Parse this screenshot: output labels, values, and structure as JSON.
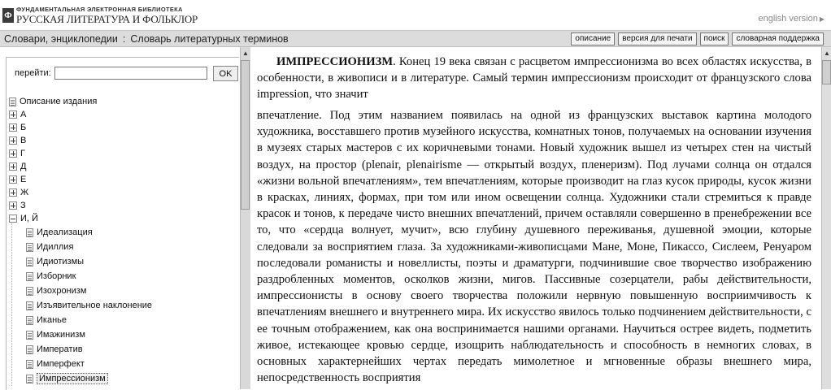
{
  "header": {
    "logo_top": "ФУНДАМЕНТАЛЬНАЯ ЭЛЕКТРОННАЯ БИБЛИОТЕКА",
    "logo_bottom": "РУССКАЯ ЛИТЕРАТУРА И ФОЛЬКЛОР",
    "english": "english version"
  },
  "titlebar": {
    "section": "Словари, энциклопедии",
    "separator": ":",
    "page": "Словарь литературных терминов",
    "buttons": [
      "описание",
      "версия для печати",
      "поиск",
      "словарная поддержка"
    ]
  },
  "goto": {
    "label": "перейти:",
    "value": "",
    "button": "OK"
  },
  "tree": {
    "root": "Описание издания",
    "letters": [
      "А",
      "Б",
      "В",
      "Г",
      "Д",
      "Е",
      "Ж",
      "З",
      "И, Й"
    ],
    "items": [
      "Идеализация",
      "Идиллия",
      "Идиотизмы",
      "Изборник",
      "Изохронизм",
      "Изъявительное наклонение",
      "Иканье",
      "Имажинизм",
      "Императив",
      "Имперфект",
      "Импрессионизм"
    ],
    "selected": "Импрессионизм"
  },
  "article": {
    "term": "ИМПРЕССИОНИЗМ",
    "para1": ". Конец 19 века связан с расцветом импрессионизма во всех областях искусства, в особенности, в живописи и в литературе. Самый термин импрессионизм происходит от французского слова impression, что значит",
    "para2": "впечатление. Под этим названием появилась на одной из французских выставок картина молодого художника, восставшего против музейного искусства, комнатных тонов, получаемых на основании изучения в музеях старых мастеров с их коричневыми тонами. Новый художник вышел из четырех стен на чистый воздух, на простор (plenair, plenairisme — открытый воздух, пленеризм). Под лучами солнца он отдался «жизни вольной впечатлениям», тем впечатлениям, которые производит на глаз кусок природы, кусок жизни в красках, линиях, формах, при том или ином освещении солнца. Художники стали стремиться к правде красок и тонов, к передаче чисто внешних впечатлений, причем оставляли совершенно в пренебрежении все то, что «сердца волнует, мучит», всю глубину душевного переживанья, душевной эмоции, которые следовали за восприятием глаза. За художниками-живописцами Мане, Моне, Пикассо, Сислеем, Ренуаром последовали романисты и новеллисты, поэты и драматурги, подчинившие свое творчество изображению раздробленных моментов, осколков жизни, мигов. Пассивные созерцатели, рабы действительности, импрессионисты в основу своего творчества положили нервную повышенную восприимчивость к впечатлениям внешнего и внутреннего мира. Их искусство явилось только подчинением действительности, с ее точным отображением, как она воспринимается нашими органами. Научиться острее видеть, подметить живое, истекающее кровью сердце, изощрить наблюдательность и способность в немногих словах, в основных характернейших чертах передать мимолетное и мгновенные образы внешнего мира, непосредственность восприятия"
  }
}
